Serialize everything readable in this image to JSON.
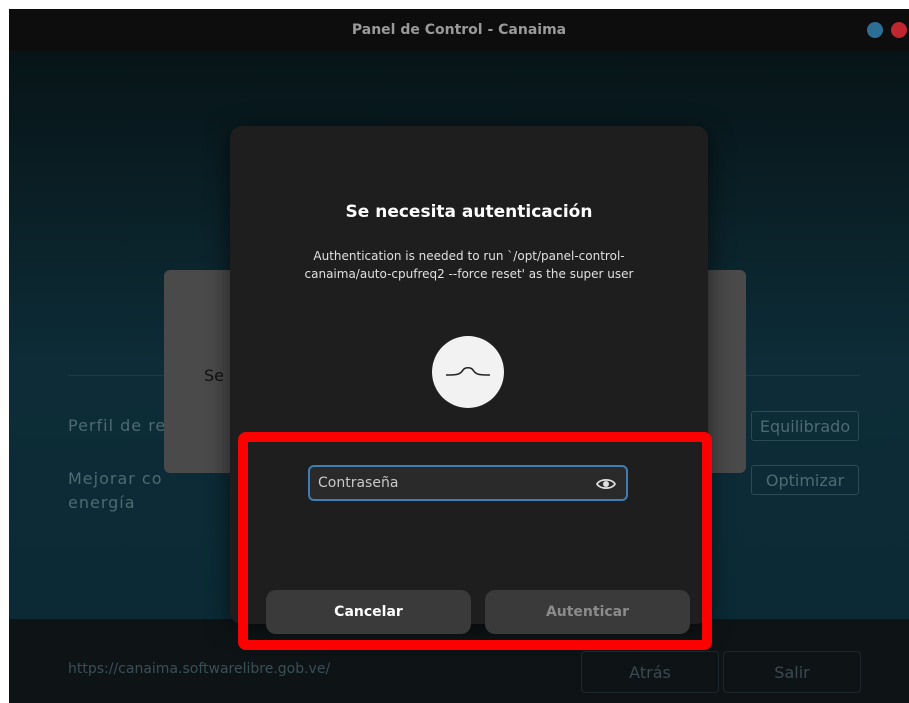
{
  "window": {
    "title": "Panel de Control - Canaima",
    "accent": "#3d7fb5",
    "close_color": "#c0262d",
    "minimize_color": "#2d6f94"
  },
  "background": {
    "rows": [
      {
        "label": "Perfil de re",
        "value": "Equilibrado"
      },
      {
        "label": "Mejorar co",
        "label2": "energía",
        "value": "Optimizar"
      }
    ],
    "dialog_text": "Se",
    "footer": {
      "url": "https://canaima.softwarelibre.gob.ve/",
      "back_label": "Atrás",
      "exit_label": "Salir"
    }
  },
  "auth_dialog": {
    "heading": "Se necesita autenticación",
    "message": "Authentication is needed to run `/opt/panel-control-canaima/auto-cpufreq2 --force reset' as the super user",
    "avatar_icon": "user-avatar-icon",
    "password_placeholder": "Contraseña",
    "password_value": "",
    "reveal_icon": "eye-icon",
    "cancel_label": "Cancelar",
    "authenticate_label": "Autenticar"
  },
  "highlight_color": "#ff0000"
}
